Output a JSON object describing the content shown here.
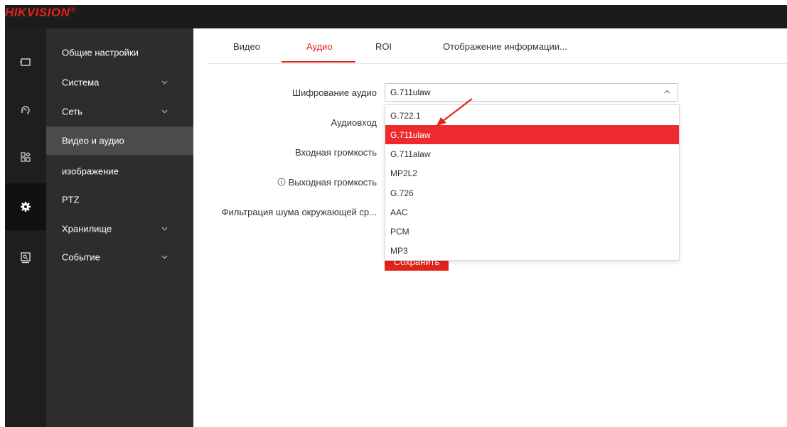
{
  "brand": {
    "name": "HIKVISION",
    "mark": "®"
  },
  "icon_rail": [
    {
      "icon": "monitor-icon",
      "active": false
    },
    {
      "icon": "ai-head-icon",
      "active": false
    },
    {
      "icon": "grid-icon",
      "active": false
    },
    {
      "icon": "gear-icon",
      "active": true
    },
    {
      "icon": "image-monitor-icon",
      "active": false
    }
  ],
  "sidebar": {
    "items": [
      {
        "label": "Общие настройки",
        "expandable": false,
        "active": false
      },
      {
        "label": "Система",
        "expandable": true,
        "active": false
      },
      {
        "label": "Сеть",
        "expandable": true,
        "active": false
      },
      {
        "label": "Видео и аудио",
        "expandable": false,
        "active": true
      },
      {
        "label": "изображение",
        "expandable": false,
        "active": false
      },
      {
        "label": "PTZ",
        "expandable": false,
        "active": false
      },
      {
        "label": "Хранилище",
        "expandable": true,
        "active": false
      },
      {
        "label": "Событие",
        "expandable": true,
        "active": false
      }
    ]
  },
  "tabs": [
    {
      "label": "Видео",
      "active": false
    },
    {
      "label": "Аудио",
      "active": true
    },
    {
      "label": "ROI",
      "active": false
    },
    {
      "label": "Отображение информации...",
      "active": false
    }
  ],
  "form": {
    "labels": {
      "audio_encoding": "Шифрование аудио",
      "audio_input": "Аудиовход",
      "input_volume": "Входная громкость",
      "output_volume": "Выходная громкость",
      "noise_filter": "Фильтрация шума окружающей ср..."
    },
    "audio_encoding_value": "G.711ulaw",
    "options": [
      "G.722.1",
      "G.711ulaw",
      "G.711alaw",
      "MP2L2",
      "G.726",
      "AAC",
      "PCM",
      "MP3"
    ],
    "selected_option": "G.711ulaw",
    "save_label": "Сохранить"
  },
  "colors": {
    "accent": "#e2231a",
    "sidebar_bg": "#2d2d2d",
    "rail_bg": "#1e1e1e",
    "topbar_bg": "#1b1b1b",
    "selected_bg": "#ee2a2f"
  }
}
